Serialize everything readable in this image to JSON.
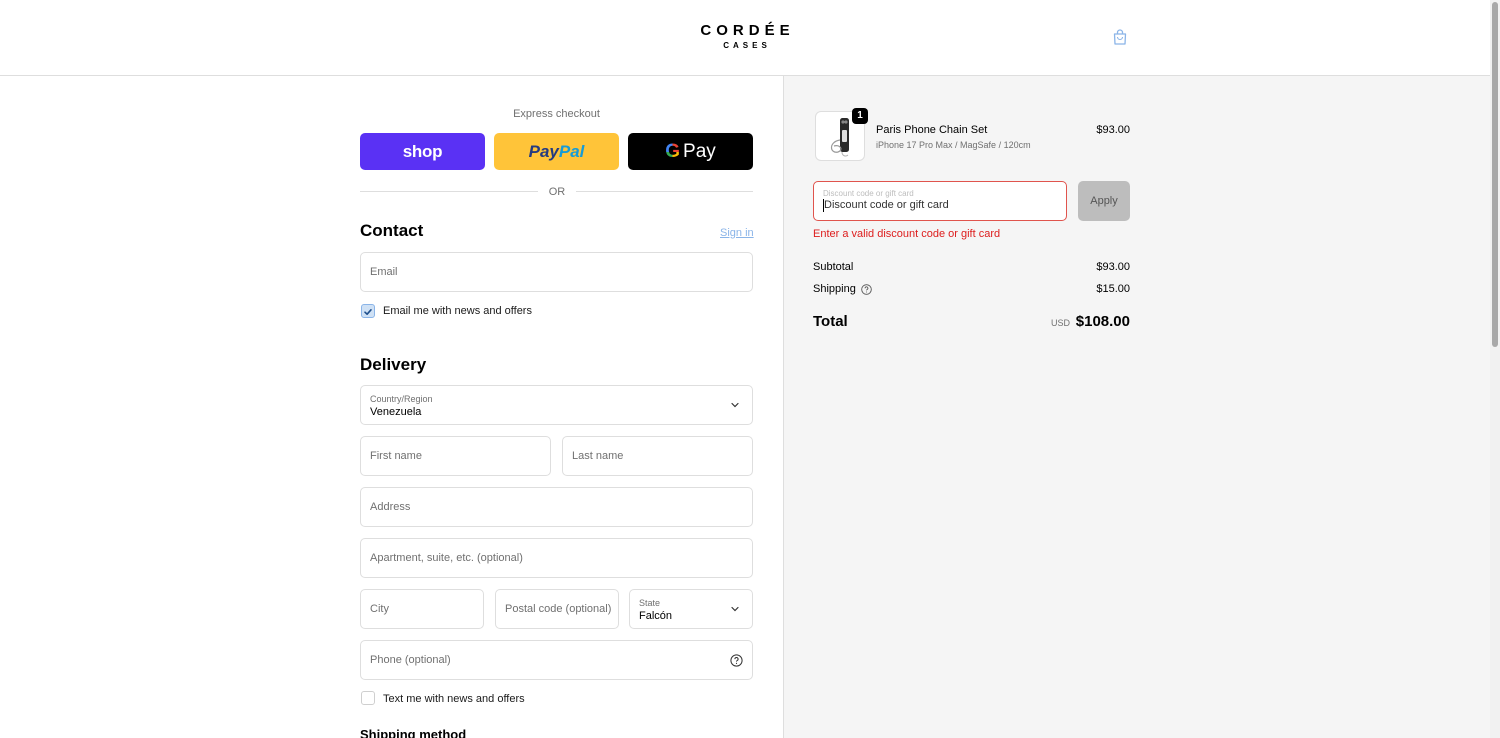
{
  "header": {
    "logo_main": "CORDÉE",
    "logo_sub": "CASES"
  },
  "express": {
    "label": "Express checkout",
    "shop_label": "shop",
    "paypal_part1": "Pay",
    "paypal_part2": "Pal",
    "gpay_g": "G",
    "gpay_label": "Pay",
    "or_label": "OR"
  },
  "contact": {
    "title": "Contact",
    "sign_in": "Sign in",
    "email_placeholder": "Email",
    "email_news_label": "Email me with news and offers",
    "email_news_checked": true
  },
  "delivery": {
    "title": "Delivery",
    "country_label": "Country/Region",
    "country_value": "Venezuela",
    "first_name_placeholder": "First name",
    "last_name_placeholder": "Last name",
    "address_placeholder": "Address",
    "apartment_placeholder": "Apartment, suite, etc. (optional)",
    "city_placeholder": "City",
    "postal_placeholder": "Postal code (optional)",
    "state_label": "State",
    "state_value": "Falcón",
    "phone_placeholder": "Phone (optional)",
    "text_news_label": "Text me with news and offers",
    "text_news_checked": false
  },
  "shipping_method": {
    "title": "Shipping method"
  },
  "summary": {
    "product": {
      "name": "Paris Phone Chain Set",
      "variant": "iPhone 17 Pro Max / MagSafe / 120cm",
      "price": "$93.00",
      "quantity": "1"
    },
    "discount": {
      "label": "Discount code or gift card",
      "value": "Discount code or gift card",
      "apply_label": "Apply",
      "error": "Enter a valid discount code or gift card"
    },
    "subtotal_label": "Subtotal",
    "subtotal_value": "$93.00",
    "shipping_label": "Shipping",
    "shipping_value": "$15.00",
    "total_label": "Total",
    "total_currency": "USD",
    "total_value": "$108.00"
  },
  "colors": {
    "shop": "#5a31f4",
    "paypal": "#ffc439",
    "gpay": "#000000",
    "error": "#dd1d1d",
    "link": "#8ab4e8"
  }
}
